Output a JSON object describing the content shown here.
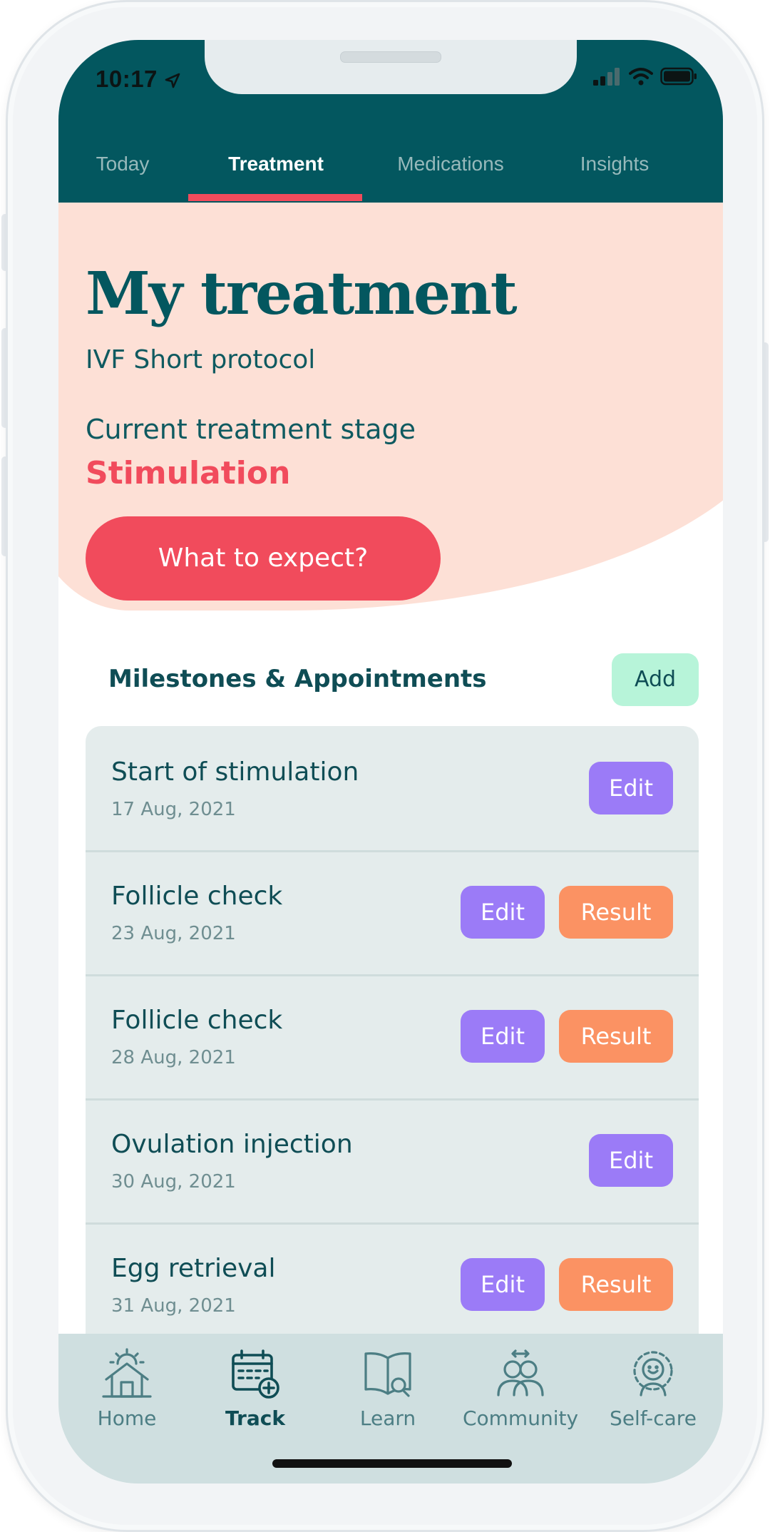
{
  "status_bar": {
    "time": "10:17"
  },
  "tabs": [
    {
      "label": "Today"
    },
    {
      "label": "Treatment"
    },
    {
      "label": "Medications"
    },
    {
      "label": "Insights"
    }
  ],
  "active_tab": "Treatment",
  "hero": {
    "title": "My treatment",
    "protocol": "IVF Short protocol",
    "stage_label": "Current treatment stage",
    "stage_value": "Stimulation",
    "cta_label": "What to expect?"
  },
  "milestones": {
    "heading": "Milestones & Appointments",
    "add_label": "Add",
    "items": [
      {
        "title": "Start of stimulation",
        "date": "17 Aug, 2021",
        "edit_label": "Edit",
        "result_label": ""
      },
      {
        "title": "Follicle check",
        "date": "23 Aug, 2021",
        "edit_label": "Edit",
        "result_label": "Result"
      },
      {
        "title": "Follicle check",
        "date": "28 Aug, 2021",
        "edit_label": "Edit",
        "result_label": "Result"
      },
      {
        "title": "Ovulation injection",
        "date": "30 Aug, 2021",
        "edit_label": "Edit",
        "result_label": ""
      },
      {
        "title": "Egg retrieval",
        "date": "31 Aug, 2021",
        "edit_label": "Edit",
        "result_label": "Result"
      }
    ]
  },
  "bottom_nav": {
    "items": [
      {
        "label": "Home",
        "icon": "home-sun-icon"
      },
      {
        "label": "Track",
        "icon": "calendar-plus-icon"
      },
      {
        "label": "Learn",
        "icon": "book-search-icon"
      },
      {
        "label": "Community",
        "icon": "people-icon"
      },
      {
        "label": "Self-care",
        "icon": "self-care-icon"
      }
    ],
    "active": "Track"
  },
  "colors": {
    "brand_teal": "#03575f",
    "accent_coral": "#f14b5c",
    "hero_bg": "#fde0d6",
    "edit_purple": "#9b7bf7",
    "result_orange": "#fb9263",
    "add_mint": "#b7f4d9"
  }
}
